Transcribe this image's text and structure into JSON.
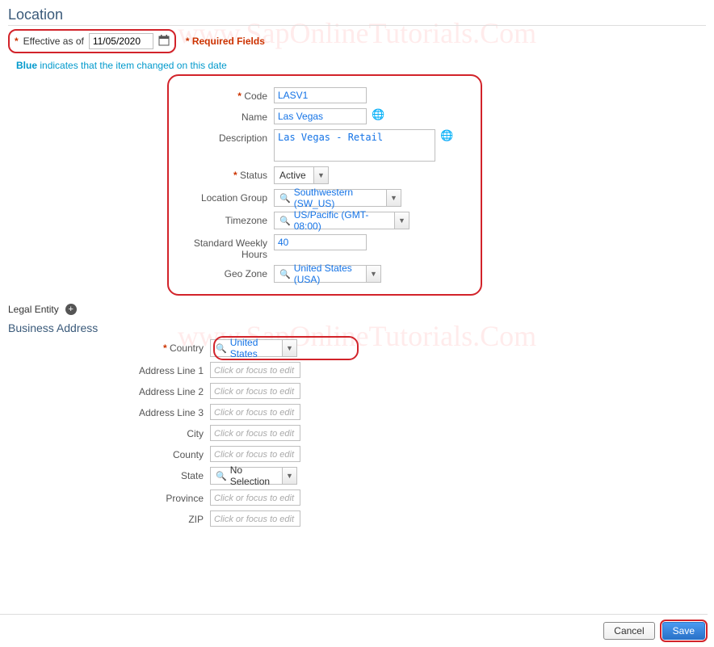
{
  "watermark": "www.SapOnlineTutorials.Com",
  "pageTitle": "Location",
  "effective": {
    "label": "Effective as of",
    "date": "11/05/2020",
    "requiredFields": "Required Fields"
  },
  "blueNote": {
    "bold": "Blue",
    "rest": " indicates that the item changed on this date"
  },
  "details": {
    "codeLabel": "Code",
    "code": "LASV1",
    "nameLabel": "Name",
    "name": "Las Vegas",
    "descLabel": "Description",
    "desc": "Las Vegas - Retail",
    "statusLabel": "Status",
    "status": "Active",
    "locGroupLabel": "Location Group",
    "locGroup": "Southwestern (SW_US)",
    "timezoneLabel": "Timezone",
    "timezone": "US/Pacific (GMT-08:00)",
    "hoursLabel": "Standard Weekly Hours",
    "hours": "40",
    "geoZoneLabel": "Geo Zone",
    "geoZone": "United States (USA)"
  },
  "legalEntityLabel": "Legal Entity",
  "businessAddressTitle": "Business Address",
  "addr": {
    "countryLabel": "Country",
    "country": "United States",
    "line1Label": "Address Line 1",
    "line2Label": "Address Line 2",
    "line3Label": "Address Line 3",
    "cityLabel": "City",
    "countyLabel": "County",
    "stateLabel": "State",
    "state": "No Selection",
    "provinceLabel": "Province",
    "zipLabel": "ZIP",
    "placeholder": "Click or focus to edit"
  },
  "footer": {
    "cancel": "Cancel",
    "save": "Save"
  }
}
